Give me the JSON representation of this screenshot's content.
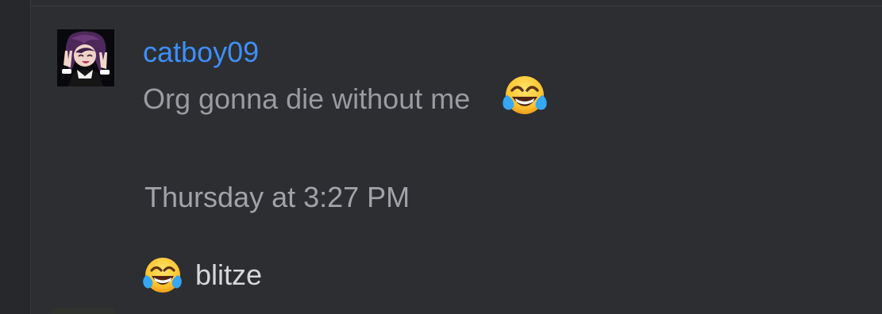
{
  "post": {
    "username": "catboy09",
    "message_text": "Org gonna die without me",
    "message_emoji": "face-with-tears-of-joy",
    "timestamp": "Thursday at 3:27 PM"
  },
  "reaction": {
    "emoji": "face-with-tears-of-joy",
    "user": "blitze"
  },
  "colors": {
    "background": "#2d2e32",
    "username": "#3f8ef6",
    "message": "#9a9ba1",
    "timestamp": "#a2a3a9",
    "reaction_user": "#d6d7db"
  }
}
